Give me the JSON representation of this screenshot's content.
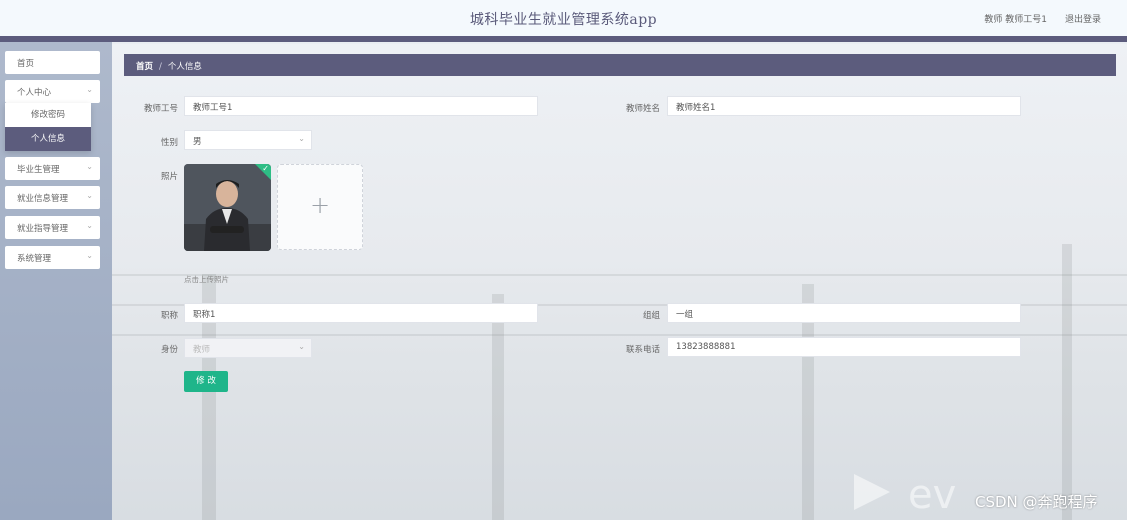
{
  "header": {
    "title": "城科毕业生就业管理系统app",
    "user_label": "教师 教师工号1",
    "logout_label": "退出登录"
  },
  "sidebar": {
    "items": [
      {
        "label": "首页"
      },
      {
        "label": "个人中心"
      },
      {
        "label": "毕业生管理"
      },
      {
        "label": "就业信息管理"
      },
      {
        "label": "就业指导管理"
      },
      {
        "label": "系统管理"
      }
    ],
    "submenu": [
      {
        "label": "修改密码"
      },
      {
        "label": "个人信息"
      }
    ]
  },
  "breadcrumb": {
    "home": "首页",
    "separator": "/",
    "current": "个人信息"
  },
  "form": {
    "teacher_id": {
      "label": "教师工号",
      "value": "教师工号1"
    },
    "teacher_name": {
      "label": "教师姓名",
      "value": "教师姓名1"
    },
    "gender": {
      "label": "性别",
      "value": "男"
    },
    "photo": {
      "label": "照片",
      "upload_tip": "点击上传照片"
    },
    "title": {
      "label": "职称",
      "value": "职称1"
    },
    "team": {
      "label": "组组",
      "value": "一组"
    },
    "role": {
      "label": "身份",
      "value": "教师"
    },
    "phone": {
      "label": "联系电话",
      "value": "13823888881"
    },
    "submit_label": "修 改"
  },
  "watermark": {
    "text": "CSDN @奔跑程序"
  },
  "colors": {
    "accent": "#5c5c7d",
    "submit": "#1fb58a",
    "check": "#2ebd85"
  }
}
